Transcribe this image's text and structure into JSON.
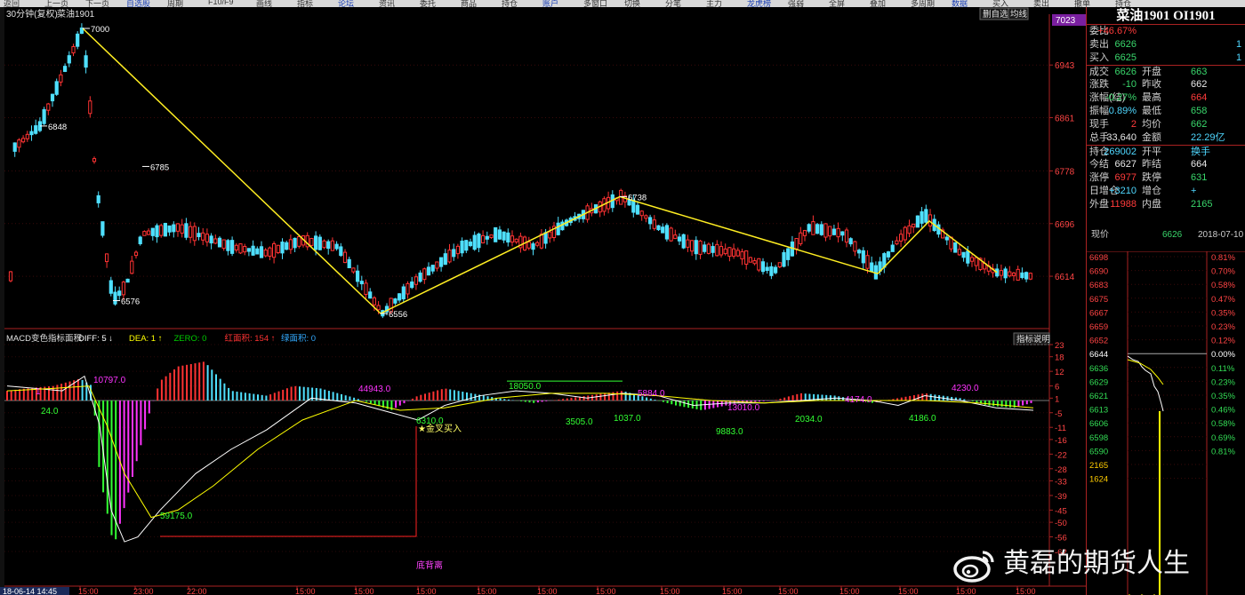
{
  "toolbar": {
    "items": [
      "返回",
      "上一页",
      "下一页",
      "自选股",
      "周期",
      "F10/F9",
      "画线",
      "指标",
      "论坛",
      "资讯",
      "委托",
      "商品",
      "持仓",
      "账户",
      "多窗口",
      "切换",
      "分笔",
      "主力",
      "龙虎榜",
      "强弱",
      "全屏",
      "叠加",
      "多周期",
      "数据",
      "买入",
      "卖出",
      "撤单",
      "持仓"
    ]
  },
  "chart": {
    "period_label": "30分钟(复权)",
    "symbol": "菜油1901",
    "top_right_buttons": [
      "删自选",
      "均线"
    ],
    "indicator_button": "指标说明",
    "price_axis": [
      "7023",
      "6943",
      "6861",
      "6778",
      "6696",
      "6614"
    ],
    "annotations": [
      "7000",
      "6848",
      "6785",
      "6576",
      "6556",
      "6738"
    ],
    "macd": {
      "name": "MACD变色指标面积",
      "items": [
        {
          "label": "DIFF:",
          "value": "5",
          "arrow": "↓",
          "color": "#ffffff"
        },
        {
          "label": "DEA:",
          "value": "1",
          "arrow": "↑",
          "color": "#ffff00"
        },
        {
          "label": "ZERO:",
          "value": "0",
          "arrow": "",
          "color": "#00cc00"
        },
        {
          "label": "红面积:",
          "value": "154",
          "arrow": "↑",
          "color": "#ff3333"
        },
        {
          "label": "绿面积:",
          "value": "0",
          "arrow": "",
          "color": "#33aaff"
        }
      ],
      "axis": [
        "23",
        "18",
        "12",
        "6",
        "1",
        "-5",
        "-11",
        "-16",
        "-22",
        "-28",
        "-33",
        "-39",
        "-45",
        "-50",
        "-56",
        "-62"
      ],
      "area_labels": [
        "1",
        "24.0",
        "10797.0",
        "44943.0",
        "6310.0",
        "18050.0",
        "3505.0",
        "1037.0",
        "9883.0",
        "5884.0",
        "13010.0",
        "2034.0",
        "4174.0",
        "4186.0",
        "4230.0",
        "59175.0"
      ],
      "signal": "★金叉买入",
      "divergence": "底背离"
    },
    "time_axis": {
      "first": "18-06-14 14:45",
      "labels": [
        "15:00",
        "23:00",
        "22:00",
        "15:00",
        "15:00",
        "15:00",
        "15:00",
        "15:00",
        "15:00",
        "15:00",
        "15:00",
        "15:00",
        "15:00",
        "15:00",
        "15:00",
        "15:00",
        "15:00"
      ]
    }
  },
  "quote": {
    "title": "菜油1901 OI1901",
    "rows": [
      {
        "l": "委比",
        "v": "+46.67%",
        "vc": "red"
      },
      {
        "l": "卖出",
        "v": "6626",
        "vc": "grn",
        "e": "1"
      },
      {
        "l": "买入",
        "v": "6625",
        "vc": "grn",
        "e": "1"
      },
      {
        "l": "成交",
        "v": "6626",
        "vc": "grn",
        "l2": "开盘",
        "v2": "663",
        "v2c": "grn",
        "sep": true
      },
      {
        "l": "涨跌",
        "v": "-10",
        "vc": "grn",
        "l2": "昨收",
        "v2": "662",
        "v2c": "white"
      },
      {
        "l": "涨幅(结)",
        "v": "-0.27%",
        "vc": "grn",
        "l2": "最高",
        "v2": "664",
        "v2c": "red"
      },
      {
        "l": "振幅",
        "v": "0.89%",
        "vc": "cyan",
        "l2": "最低",
        "v2": "658",
        "v2c": "grn"
      },
      {
        "l": "现手",
        "v": "2",
        "vc": "red",
        "l2": "均价",
        "v2": "662",
        "v2c": "grn"
      },
      {
        "l": "总手",
        "v": "33,640",
        "vc": "white",
        "l2": "金额",
        "v2": "22.29亿",
        "v2c": "cyan"
      },
      {
        "l": "持仓",
        "v": "269002",
        "vc": "cyan",
        "l2": "开平",
        "v2": "换手",
        "v2c": "cyan",
        "sep": true
      },
      {
        "l": "今结",
        "v": "6627",
        "vc": "white",
        "l2": "昨结",
        "v2": "664",
        "v2c": "white"
      },
      {
        "l": "涨停",
        "v": "6977",
        "vc": "red",
        "l2": "跌停",
        "v2": "631",
        "v2c": "grn"
      },
      {
        "l": "日增仓",
        "v": "+3210",
        "vc": "cyan",
        "l2": "增仓",
        "v2": "+",
        "v2c": "cyan"
      },
      {
        "l": "外盘",
        "v": "11988",
        "vc": "red",
        "l2": "内盘",
        "v2": "2165",
        "v2c": "grn"
      }
    ],
    "current": {
      "label": "现价",
      "value": "6626",
      "date": "2018-07-10 二"
    },
    "mini_left": [
      "6698",
      "6690",
      "6683",
      "6675",
      "6667",
      "6659",
      "6652",
      "6644",
      "6636",
      "6629",
      "6621",
      "6613",
      "6606",
      "6598",
      "6590",
      "2165",
      "1624"
    ],
    "mini_right": [
      "0.81%",
      "0.70%",
      "0.58%",
      "0.47%",
      "0.35%",
      "0.23%",
      "0.12%",
      "0.00%",
      "0.11%",
      "0.23%",
      "0.35%",
      "0.46%",
      "0.58%",
      "0.69%",
      "0.81%"
    ]
  },
  "watermark": "黄磊的期货人生"
}
